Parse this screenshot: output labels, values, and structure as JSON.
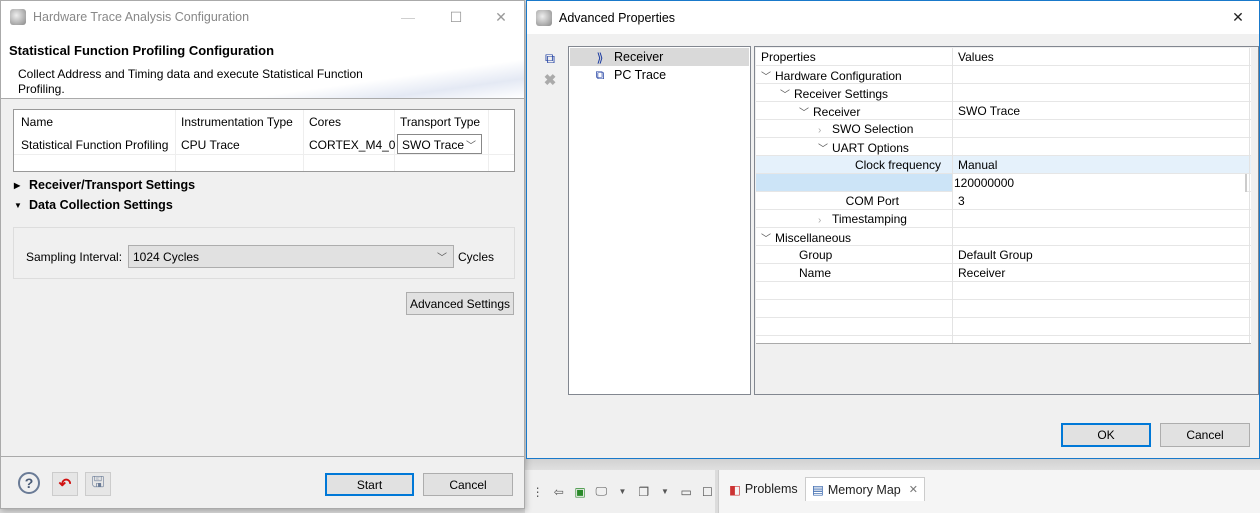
{
  "ide_background": {
    "tabs": [
      {
        "label": "Problems",
        "icon": "problems-icon",
        "active": false
      },
      {
        "label": "Memory Map",
        "icon": "memory-map-icon",
        "active": true,
        "close_icon": "close-tab-icon"
      }
    ],
    "toolbar_icons": [
      "layout-icon",
      "import-icon",
      "pin-icon",
      "display-icon",
      "dropdown-icon",
      "new-window-icon",
      "dropdown-icon",
      "minimize-icon",
      "maximize-icon"
    ]
  },
  "main_dialog": {
    "window_title": "Hardware Trace Analysis Configuration",
    "header_title": "Statistical Function Profiling Configuration",
    "header_description": "Collect Address and Timing data and execute Statistical Function Profiling.",
    "table": {
      "columns": [
        "Name",
        "Instrumentation Type",
        "Cores",
        "Transport Type"
      ],
      "rows": [
        {
          "name": "Statistical Function Profiling",
          "instrumentation_type": "CPU Trace",
          "cores": "CORTEX_M4_0",
          "transport_type": "SWO Trace"
        }
      ]
    },
    "sections": [
      {
        "label": "Receiver/Transport Settings",
        "expanded": false
      },
      {
        "label": "Data Collection Settings",
        "expanded": true
      }
    ],
    "sampling_interval": {
      "label": "Sampling Interval:",
      "value": "1024 Cycles",
      "unit_label": "Cycles"
    },
    "advanced_settings_label": "Advanced Settings",
    "footer": {
      "icons": [
        "help-icon",
        "restore-defaults-icon",
        "save-icon"
      ],
      "start_label": "Start",
      "cancel_label": "Cancel"
    }
  },
  "advanced_dialog": {
    "window_title": "Advanced Properties",
    "nav_items": [
      {
        "label": "Receiver",
        "icon": "receiver-icon",
        "selected": true
      },
      {
        "label": "PC Trace",
        "icon": "pc-trace-icon",
        "selected": false
      }
    ],
    "side_tools": [
      "add-icon",
      "remove-icon"
    ],
    "properties_header": {
      "name": "Properties",
      "value": "Values"
    },
    "properties": [
      {
        "name": "Hardware Configuration",
        "value": "",
        "level": 0,
        "state": "expanded"
      },
      {
        "name": "Receiver Settings",
        "value": "",
        "level": 1,
        "state": "expanded"
      },
      {
        "name": "Receiver",
        "value": "SWO Trace",
        "level": 2,
        "state": "expanded"
      },
      {
        "name": "SWO Selection",
        "value": "",
        "level": 3,
        "state": "collapsed"
      },
      {
        "name": "UART Options",
        "value": "",
        "level": 3,
        "state": "expanded"
      },
      {
        "name": "Clock frequency",
        "value": "Manual",
        "level": 4,
        "state": "leaf",
        "align": "right",
        "highlight": true
      },
      {
        "name": "",
        "value": "120000000",
        "level": 4,
        "state": "editing"
      },
      {
        "name": "COM Port",
        "value": "3",
        "level": 4,
        "state": "leaf",
        "align": "right"
      },
      {
        "name": "Timestamping",
        "value": "",
        "level": 3,
        "state": "collapsed"
      },
      {
        "name": "Miscellaneous",
        "value": "",
        "level": 0,
        "state": "expanded"
      },
      {
        "name": "Group",
        "value": "Default Group",
        "level": 1,
        "state": "leaf"
      },
      {
        "name": "Name",
        "value": "Receiver",
        "level": 1,
        "state": "leaf"
      }
    ],
    "ok_label": "OK",
    "cancel_label": "Cancel"
  }
}
